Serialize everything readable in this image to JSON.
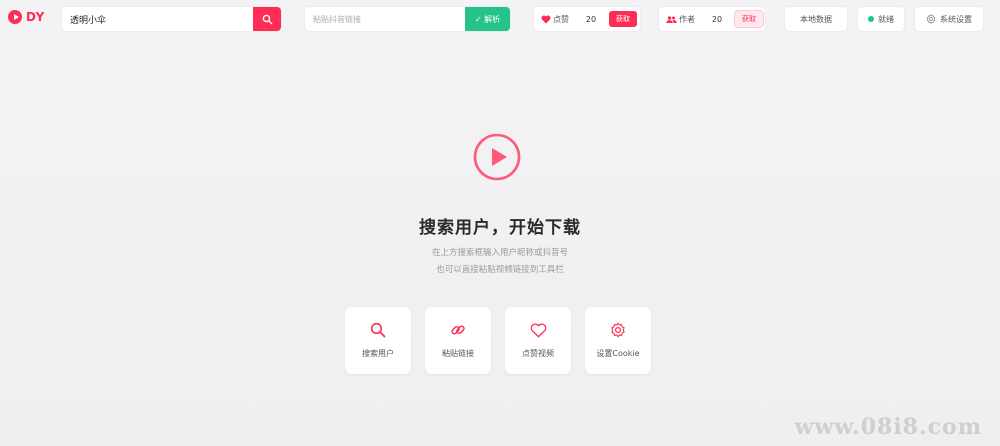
{
  "app": {
    "logo_text": "DY",
    "accent_color": "#ff2d55",
    "success_color": "#25c28a"
  },
  "toolbar": {
    "search": {
      "value": "透明小伞",
      "icon": "search-icon"
    },
    "link": {
      "placeholder": "粘贴抖音链接",
      "parse_label": "✓ 解析"
    },
    "likes": {
      "label": "点赞",
      "icon": "heart-icon",
      "count": "20",
      "get_label": "获取"
    },
    "authors": {
      "label": "作者",
      "icon": "users-icon",
      "count": "20",
      "get_label": "获取"
    },
    "local_data_label": "本地数据",
    "status_label": "就绪",
    "settings_label": "系统设置"
  },
  "empty_state": {
    "icon": "play-icon",
    "title": "搜索用户，开始下载",
    "subtitle_line1": "在上方搜索框输入用户昵称或抖音号",
    "subtitle_line2": "也可以直接粘贴视频链接到工具栏"
  },
  "quick_actions": [
    {
      "label": "搜索用户",
      "icon": "search-icon"
    },
    {
      "label": "粘贴链接",
      "icon": "link-icon"
    },
    {
      "label": "点赞视频",
      "icon": "heart-icon"
    },
    {
      "label": "设置Cookie",
      "icon": "gear-icon"
    }
  ],
  "watermark": "www.08i8.com"
}
